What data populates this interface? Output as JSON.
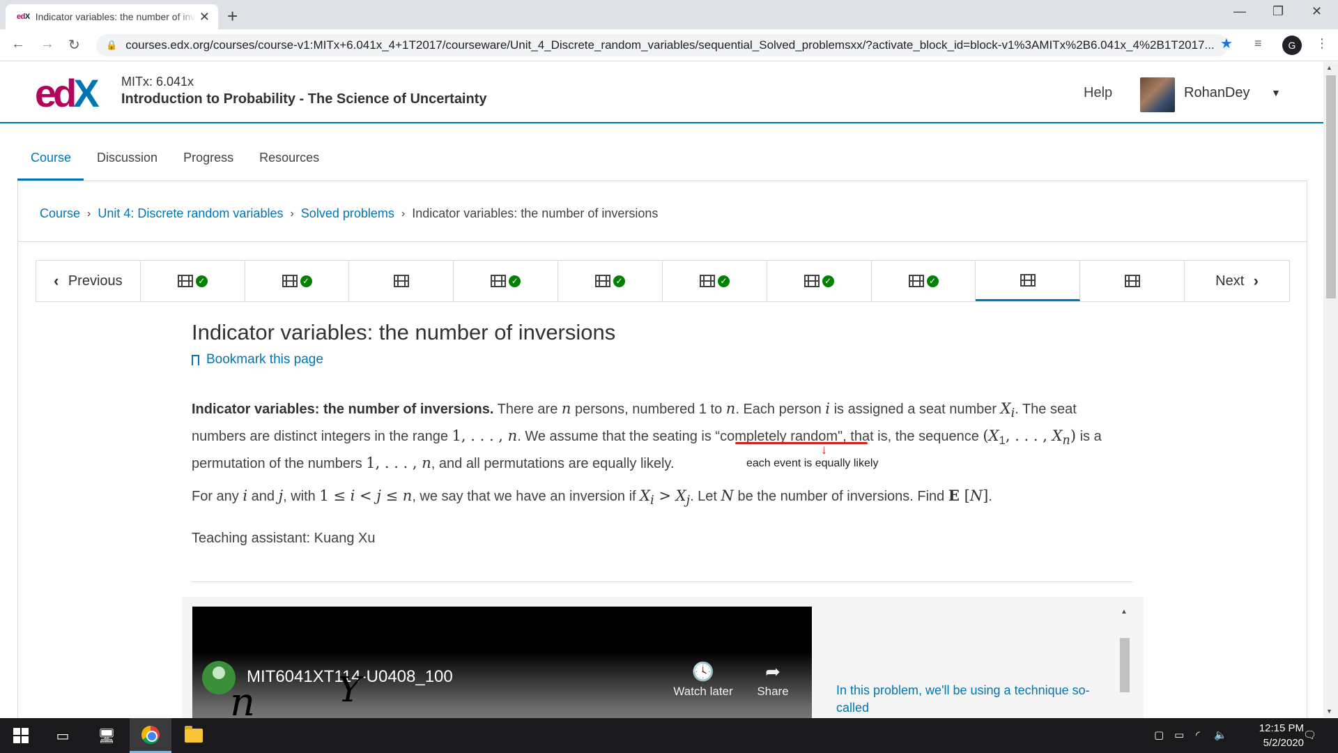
{
  "browser": {
    "tab_favicon_text": "edX",
    "tab_title": "Indicator variables: the number of inversions",
    "tab_close": "✕",
    "new_tab": "+",
    "url": "courses.edx.org/courses/course-v1:MITx+6.041x_4+1T2017/courseware/Unit_4_Discrete_random_variables/sequential_Solved_problemsxx/?activate_block_id=block-v1%3AMITx%2B6.041x_4%2B1T2017...",
    "profile_letter": "G"
  },
  "header": {
    "course_org": "MITx: 6.041x",
    "course_name": "Introduction to Probability - The Science of Uncertainty",
    "help": "Help",
    "username": "RohanDey"
  },
  "course_nav": [
    {
      "label": "Course",
      "active": true
    },
    {
      "label": "Discussion",
      "active": false
    },
    {
      "label": "Progress",
      "active": false
    },
    {
      "label": "Resources",
      "active": false
    }
  ],
  "breadcrumb": {
    "items": [
      "Course",
      "Unit 4: Discrete random variables",
      "Solved problems"
    ],
    "current": "Indicator variables: the number of inversions"
  },
  "sequence": {
    "previous": "Previous",
    "next": "Next",
    "units": [
      {
        "icon": "video",
        "completed": true
      },
      {
        "icon": "video",
        "completed": true
      },
      {
        "icon": "video",
        "completed": false
      },
      {
        "icon": "video",
        "completed": true
      },
      {
        "icon": "video",
        "completed": true
      },
      {
        "icon": "video",
        "completed": true
      },
      {
        "icon": "video",
        "completed": true
      },
      {
        "icon": "video",
        "completed": true
      },
      {
        "icon": "video",
        "completed": false,
        "active": true
      },
      {
        "icon": "video",
        "completed": false
      }
    ]
  },
  "content": {
    "title": "Indicator variables: the number of inversions",
    "bookmark": "Bookmark this page",
    "problem_bold": "Indicator variables: the number of inversions.",
    "teaching_assistant": "Teaching assistant: Kuang Xu",
    "annotation": "each event is equally likely"
  },
  "video": {
    "title": "MIT6041XT114-U0408_100",
    "watch_later": "Watch later",
    "share": "Share",
    "transcript_line": "In this problem, we'll be using a technique so-called",
    "scribble_1": "n",
    "scribble_2": "Y"
  },
  "taskbar": {
    "time": "12:15 PM",
    "date": "5/2/2020"
  }
}
